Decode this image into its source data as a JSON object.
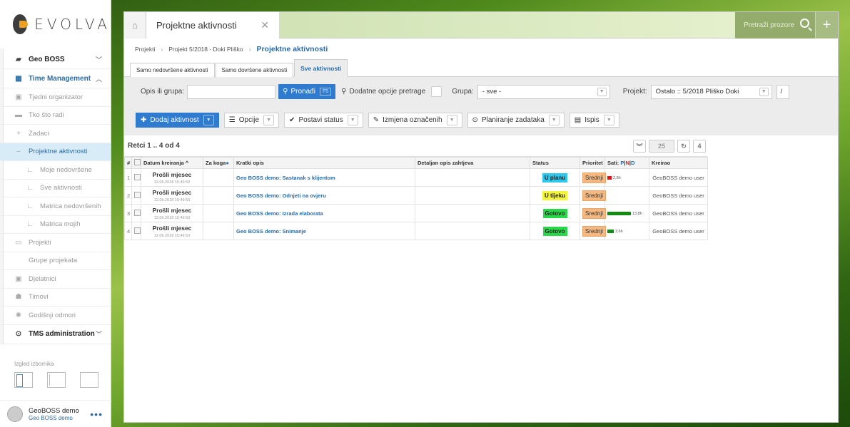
{
  "brand": "EVOLVA",
  "sidebar": {
    "items": [
      {
        "label": "Geo BOSS",
        "icon": "book-icon",
        "style": "bold"
      },
      {
        "label": "Time Management",
        "icon": "calendar-icon",
        "style": "bold-blue"
      },
      {
        "label": "Tjedni organizator",
        "icon": "calendar-small-icon",
        "style": "normal"
      },
      {
        "label": "Tko što radi",
        "icon": "list-icon",
        "style": "normal"
      },
      {
        "label": "Zadaci",
        "icon": "plus-icon",
        "style": "normal"
      },
      {
        "label": "Projektne aktivnosti",
        "icon": "minus-icon",
        "style": "active"
      },
      {
        "label": "Moje nedovršene",
        "icon": "sub-icon",
        "style": "sub"
      },
      {
        "label": "Sve aktivnosti",
        "icon": "sub-icon",
        "style": "sub"
      },
      {
        "label": "Matrica nedovršenih",
        "icon": "sub-icon",
        "style": "sub"
      },
      {
        "label": "Matrica mojih",
        "icon": "sub-icon",
        "style": "sub"
      },
      {
        "label": "Projekti",
        "icon": "folder-icon",
        "style": "normal"
      },
      {
        "label": "Grupe projekata",
        "icon": "",
        "style": "normal"
      },
      {
        "label": "Djelatnici",
        "icon": "person-icon",
        "style": "normal"
      },
      {
        "label": "Timovi",
        "icon": "team-icon",
        "style": "normal"
      },
      {
        "label": "Godišnji odmori",
        "icon": "sun-icon",
        "style": "normal"
      },
      {
        "label": "TMS administration",
        "icon": "clock-icon",
        "style": "bold"
      }
    ],
    "layout_label": "Izgled izbornika",
    "user_name": "GeoBOSS demo",
    "user_sub": "Geo BOSS demo"
  },
  "tabs": {
    "active_title": "Projektne aktivnosti",
    "search_placeholder": "Pretraži prozore"
  },
  "breadcrumb": {
    "items": [
      "Projekti",
      "Projekt 5/2018 - Doki Pliško"
    ],
    "current": "Projektne aktivnosti"
  },
  "subtabs": [
    "Samo nedovršene aktivnosti",
    "Samo dovršene aktivnosti",
    "Sve aktivnosti"
  ],
  "filters": {
    "opis_label": "Opis ili grupa:",
    "opis_value": "",
    "find_label": "Pronađi",
    "find_key": "F5",
    "advanced_label": "Dodatne opcije pretrage",
    "grupa_label": "Grupa:",
    "grupa_value": "- sve -",
    "projekt_label": "Projekt:",
    "projekt_value": "Ostalo :: 5/2018 Pliško Doki",
    "slash": "/"
  },
  "toolbar": {
    "add": "Dodaj aktivnost",
    "options": "Opcije",
    "status": "Postavi status",
    "edit": "Izmjena označenih",
    "plan": "Planiranje zadataka",
    "print": "Ispis"
  },
  "grid": {
    "rows_label": "Retci 1 .. 4 od 4",
    "page_size": "25",
    "count": "4",
    "headers": {
      "num": "#",
      "date": "Datum kreiranja",
      "for": "Za koga",
      "short": "Kratki opis",
      "detail": "Detaljan opis zahtjeva",
      "status": "Status",
      "prio": "Prioritet",
      "hours": "Sati:",
      "hours_p": "P",
      "hours_n": "N",
      "hours_d": "D",
      "creator": "Kreirao"
    },
    "rows": [
      {
        "n": "1",
        "date": "Prošli mjesec",
        "ts": "12.06.2018 15:49:53",
        "title": "Geo BOSS demo: Sastanak s klijentom",
        "status": "U planu",
        "status_color": "#2fc7ea",
        "prio": "Srednji",
        "bar_color": "#e81010",
        "bar_frac": 0.06,
        "hours": "2,8h",
        "creator": "GeoBOSS demo user"
      },
      {
        "n": "2",
        "date": "Prošli mjesec",
        "ts": "12.06.2018 15:49:53",
        "title": "Geo BOSS demo: Odnjeti na ovjeru",
        "status": "U tijeku",
        "status_color": "#f4f43a",
        "prio": "Srednji",
        "bar_color": "",
        "bar_frac": 0,
        "hours": "",
        "creator": "GeoBOSS demo user"
      },
      {
        "n": "3",
        "date": "Prošli mjesec",
        "ts": "12.06.2018 15:49:53",
        "title": "Geo BOSS demo: Izrada elaborata",
        "status": "Gotovo",
        "status_color": "#28d848",
        "prio": "Srednji",
        "bar_color": "#118a11",
        "bar_frac": 0.33,
        "hours": "13,8h",
        "creator": "GeoBOSS demo user"
      },
      {
        "n": "4",
        "date": "Prošli mjesec",
        "ts": "12.06.2018 15:49:53",
        "title": "Geo BOSS demo: Snimanje",
        "status": "Gotovo",
        "status_color": "#28d848",
        "prio": "Srednji",
        "bar_color": "#118a11",
        "bar_frac": 0.09,
        "hours": "3,6h",
        "creator": "GeoBOSS demo user"
      }
    ]
  }
}
